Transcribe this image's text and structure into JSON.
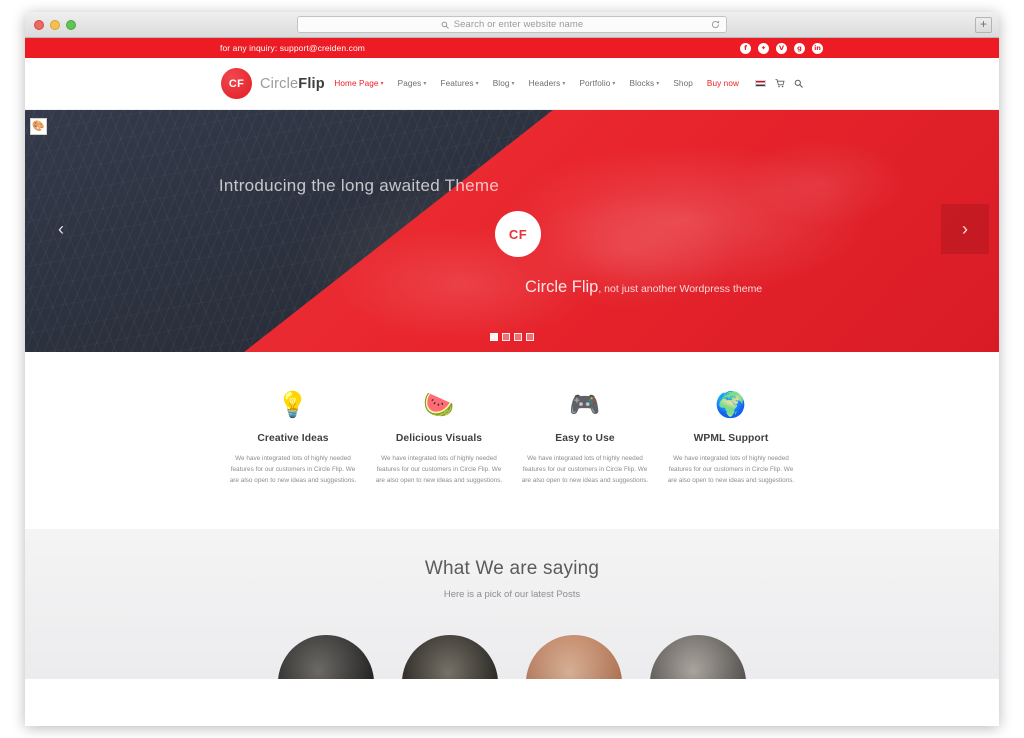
{
  "browser": {
    "address_placeholder": "Search or enter website name",
    "search_icon": "search-icon",
    "reload_icon": "reload-icon",
    "newtab_label": "+",
    "traffic_lights": [
      "close",
      "minimize",
      "zoom"
    ]
  },
  "topbar": {
    "inquiry": "for any inquiry: support@creiden.com",
    "social": [
      {
        "name": "facebook",
        "glyph": "f"
      },
      {
        "name": "twitter",
        "glyph": "✦"
      },
      {
        "name": "vimeo",
        "glyph": "V"
      },
      {
        "name": "google-plus",
        "glyph": "g"
      },
      {
        "name": "linkedin",
        "glyph": "in"
      }
    ]
  },
  "header": {
    "logo_mark": "CF",
    "logo_word_1": "Circle",
    "logo_word_2": "Flip",
    "nav": [
      {
        "label": "Home Page",
        "caret": true,
        "active": true
      },
      {
        "label": "Pages",
        "caret": true,
        "active": false
      },
      {
        "label": "Features",
        "caret": true,
        "active": false
      },
      {
        "label": "Blog",
        "caret": true,
        "active": false
      },
      {
        "label": "Headers",
        "caret": true,
        "active": false
      },
      {
        "label": "Portfolio",
        "caret": true,
        "active": false
      },
      {
        "label": "Blocks",
        "caret": true,
        "active": false
      },
      {
        "label": "Shop",
        "caret": false,
        "active": false
      },
      {
        "label": "Buy now",
        "caret": false,
        "active": false,
        "buy": true
      }
    ],
    "icons": [
      "flag-icon",
      "cart-icon",
      "search-icon"
    ]
  },
  "hero": {
    "badge_icon": "image-badge-icon",
    "headline": "Introducing the long awaited Theme",
    "circle_mark": "CF",
    "sub_brand": "Circle Flip",
    "sub_tagline": ", not just another Wordpress theme",
    "prev_arrow": "‹",
    "next_arrow": "›",
    "dots": 4,
    "active_dot": 1
  },
  "features": [
    {
      "icon": "💡",
      "icon_name": "lightbulb-icon",
      "title": "Creative Ideas",
      "body": "We have integrated lots of highly needed features for our customers in Circle Flip. We are also open to new ideas and suggestions."
    },
    {
      "icon": "🍉",
      "icon_name": "watermelon-icon",
      "title": "Delicious Visuals",
      "body": "We have integrated lots of highly needed features for our customers in Circle Flip. We are also open to new ideas and suggestions."
    },
    {
      "icon": "🎮",
      "icon_name": "gamepad-icon",
      "title": "Easy to Use",
      "body": "We have integrated lots of highly needed features for our customers in Circle Flip. We are also open to new ideas and suggestions."
    },
    {
      "icon": "🌍",
      "icon_name": "globe-icon",
      "title": "WPML Support",
      "body": "We have integrated lots of highly needed features for our customers in Circle Flip. We are also open to new ideas and suggestions."
    }
  ],
  "posts": {
    "title": "What We are saying",
    "subtitle": "Here is a pick of our latest Posts",
    "thumbs": 4
  },
  "colors": {
    "brand_red": "#ed1c24",
    "hero_red": "#e8242c",
    "hero_dark": "#2b303d",
    "text_gray": "#8d8d8d"
  }
}
